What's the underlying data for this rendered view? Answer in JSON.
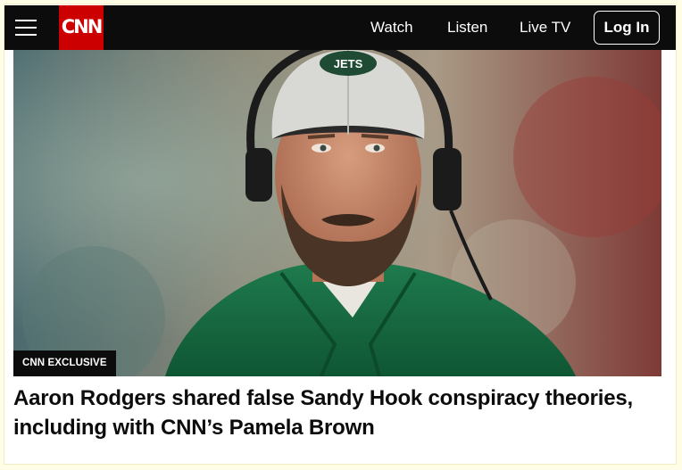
{
  "header": {
    "menu_icon": "hamburger-menu-icon",
    "logo_text": "CNN",
    "brand_color": "#cc0000",
    "nav": [
      "Watch",
      "Listen",
      "Live TV"
    ],
    "login_label": "Log In"
  },
  "story": {
    "badge": "CNN EXCLUSIVE",
    "headline": "Aaron Rodgers shared false Sandy Hook conspiracy theories, including with CNN’s Pamela Brown",
    "cap_logo": "JETS"
  }
}
